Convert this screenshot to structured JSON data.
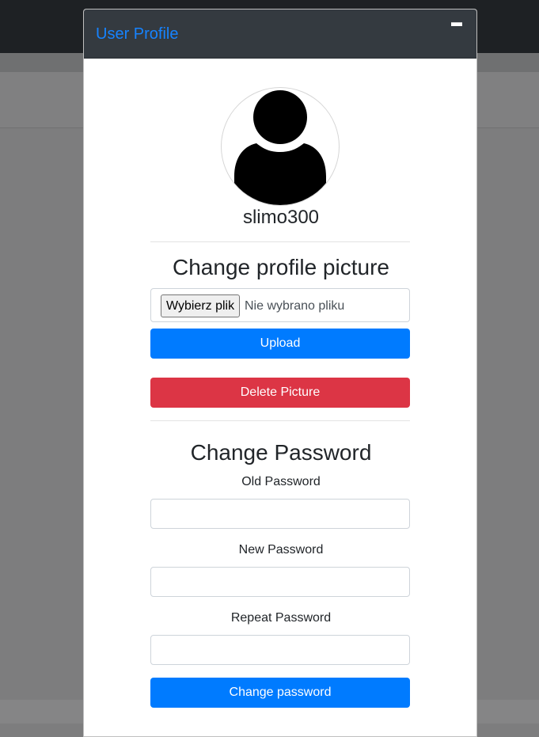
{
  "modal": {
    "title": "User Profile",
    "minimize_icon": "minimize-icon"
  },
  "profile": {
    "avatar_icon": "user-silhouette-icon",
    "username": "slimo300"
  },
  "picture_section": {
    "title": "Change profile picture",
    "file_button_label": "Wybierz plik",
    "file_status": "Nie wybrano pliku",
    "upload_label": "Upload",
    "delete_label": "Delete Picture"
  },
  "password_section": {
    "title": "Change Password",
    "old_label": "Old Password",
    "old_value": "",
    "new_label": "New Password",
    "new_value": "",
    "repeat_label": "Repeat Password",
    "repeat_value": "",
    "submit_label": "Change password"
  },
  "colors": {
    "accent": "#007bff",
    "danger": "#dc3545",
    "title": "#1683ff",
    "header": "#343a40"
  }
}
